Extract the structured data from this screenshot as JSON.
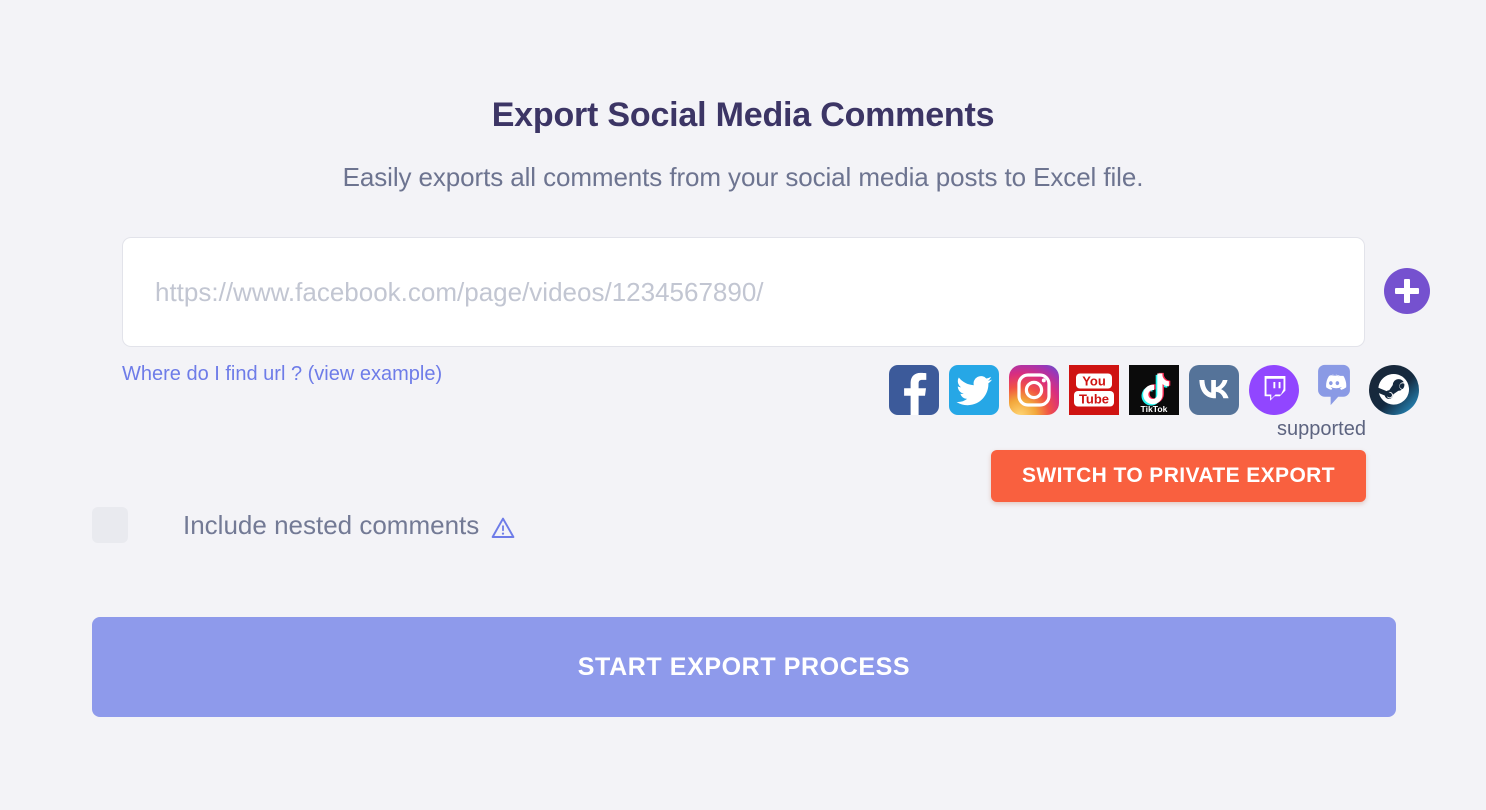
{
  "header": {
    "title": "Export Social Media Comments",
    "subtitle": "Easily exports all comments from your social media posts to Excel file."
  },
  "url_field": {
    "placeholder": "https://www.facebook.com/page/videos/1234567890/",
    "value": "",
    "add_button_icon": "plus-icon"
  },
  "help_link": {
    "label": "Where do I find url ? (view example)"
  },
  "socials": {
    "supported_label": "supported",
    "items": [
      {
        "name": "facebook",
        "label": "Facebook"
      },
      {
        "name": "twitter",
        "label": "Twitter"
      },
      {
        "name": "instagram",
        "label": "Instagram"
      },
      {
        "name": "youtube",
        "label": "YouTube"
      },
      {
        "name": "tiktok",
        "label": "TikTok"
      },
      {
        "name": "vk",
        "label": "VK"
      },
      {
        "name": "twitch",
        "label": "Twitch"
      },
      {
        "name": "discord",
        "label": "Discord"
      },
      {
        "name": "steam",
        "label": "Steam"
      }
    ]
  },
  "private_export": {
    "label": "SWITCH TO PRIVATE EXPORT"
  },
  "nested_comments": {
    "label": "Include nested comments",
    "checked": false,
    "warning_icon": "warning-triangle-icon"
  },
  "start_export": {
    "label": "START EXPORT PROCESS"
  },
  "colors": {
    "page_background": "#f3f3f7",
    "title": "#3c3565",
    "subtitle": "#6d7490",
    "link": "#6e7ce8",
    "add_button": "#7551cf",
    "private_button": "#f9603f",
    "start_button": "#8e9aeb",
    "checkbox": "#e9eaef",
    "warning": "#6e7ce8"
  }
}
